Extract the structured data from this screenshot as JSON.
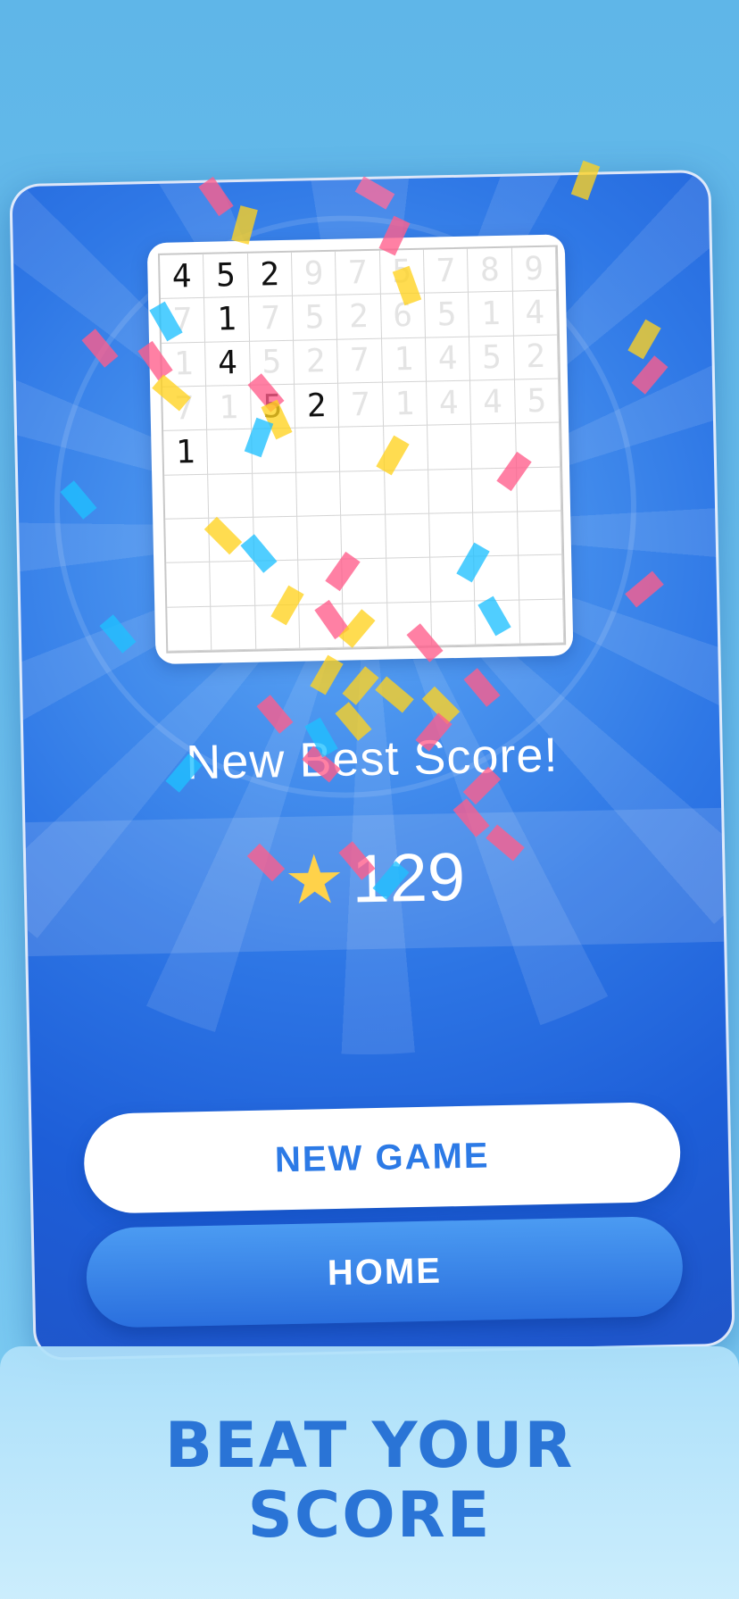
{
  "grid": {
    "rows": [
      [
        {
          "v": "4",
          "a": true
        },
        {
          "v": "5",
          "a": true
        },
        {
          "v": "2",
          "a": true
        },
        {
          "v": "9",
          "a": false
        },
        {
          "v": "7",
          "a": false
        },
        {
          "v": "5",
          "a": false
        },
        {
          "v": "7",
          "a": false
        },
        {
          "v": "8",
          "a": false
        },
        {
          "v": "9",
          "a": false
        }
      ],
      [
        {
          "v": "7",
          "a": false
        },
        {
          "v": "1",
          "a": true
        },
        {
          "v": "7",
          "a": false
        },
        {
          "v": "5",
          "a": false
        },
        {
          "v": "2",
          "a": false
        },
        {
          "v": "6",
          "a": false
        },
        {
          "v": "5",
          "a": false
        },
        {
          "v": "1",
          "a": false
        },
        {
          "v": "4",
          "a": false
        }
      ],
      [
        {
          "v": "1",
          "a": false
        },
        {
          "v": "4",
          "a": true
        },
        {
          "v": "5",
          "a": false
        },
        {
          "v": "2",
          "a": false
        },
        {
          "v": "7",
          "a": false
        },
        {
          "v": "1",
          "a": false
        },
        {
          "v": "4",
          "a": false
        },
        {
          "v": "5",
          "a": false
        },
        {
          "v": "2",
          "a": false
        }
      ],
      [
        {
          "v": "7",
          "a": false
        },
        {
          "v": "1",
          "a": false
        },
        {
          "v": "5",
          "a": true
        },
        {
          "v": "2",
          "a": true
        },
        {
          "v": "7",
          "a": false
        },
        {
          "v": "1",
          "a": false
        },
        {
          "v": "4",
          "a": false
        },
        {
          "v": "4",
          "a": false
        },
        {
          "v": "5",
          "a": false
        }
      ],
      [
        {
          "v": "1",
          "a": true
        },
        {
          "v": "",
          "a": false
        },
        {
          "v": "",
          "a": false
        },
        {
          "v": "",
          "a": false
        },
        {
          "v": "",
          "a": false
        },
        {
          "v": "",
          "a": false
        },
        {
          "v": "",
          "a": false
        },
        {
          "v": "",
          "a": false
        },
        {
          "v": "",
          "a": false
        }
      ],
      [
        {
          "v": "",
          "a": false
        },
        {
          "v": "",
          "a": false
        },
        {
          "v": "",
          "a": false
        },
        {
          "v": "",
          "a": false
        },
        {
          "v": "",
          "a": false
        },
        {
          "v": "",
          "a": false
        },
        {
          "v": "",
          "a": false
        },
        {
          "v": "",
          "a": false
        },
        {
          "v": "",
          "a": false
        }
      ],
      [
        {
          "v": "",
          "a": false
        },
        {
          "v": "",
          "a": false
        },
        {
          "v": "",
          "a": false
        },
        {
          "v": "",
          "a": false
        },
        {
          "v": "",
          "a": false
        },
        {
          "v": "",
          "a": false
        },
        {
          "v": "",
          "a": false
        },
        {
          "v": "",
          "a": false
        },
        {
          "v": "",
          "a": false
        }
      ],
      [
        {
          "v": "",
          "a": false
        },
        {
          "v": "",
          "a": false
        },
        {
          "v": "",
          "a": false
        },
        {
          "v": "",
          "a": false
        },
        {
          "v": "",
          "a": false
        },
        {
          "v": "",
          "a": false
        },
        {
          "v": "",
          "a": false
        },
        {
          "v": "",
          "a": false
        },
        {
          "v": "",
          "a": false
        }
      ],
      [
        {
          "v": "",
          "a": false
        },
        {
          "v": "",
          "a": false
        },
        {
          "v": "",
          "a": false
        },
        {
          "v": "",
          "a": false
        },
        {
          "v": "",
          "a": false
        },
        {
          "v": "",
          "a": false
        },
        {
          "v": "",
          "a": false
        },
        {
          "v": "",
          "a": false
        },
        {
          "v": "",
          "a": false
        }
      ]
    ]
  },
  "result": {
    "title": "New Best Score!",
    "score": "129",
    "star_icon": "star-icon"
  },
  "buttons": {
    "new_game": "NEW GAME",
    "home": "HOME"
  },
  "tagline": {
    "line1": "BEAT YOUR",
    "line2": "SCORE"
  },
  "colors": {
    "accent": "#2c7ae6",
    "star": "#ffd24a",
    "confetti": [
      "#ff5c8a",
      "#ffd21f",
      "#1fc0ff",
      "#ff6b9b"
    ]
  }
}
